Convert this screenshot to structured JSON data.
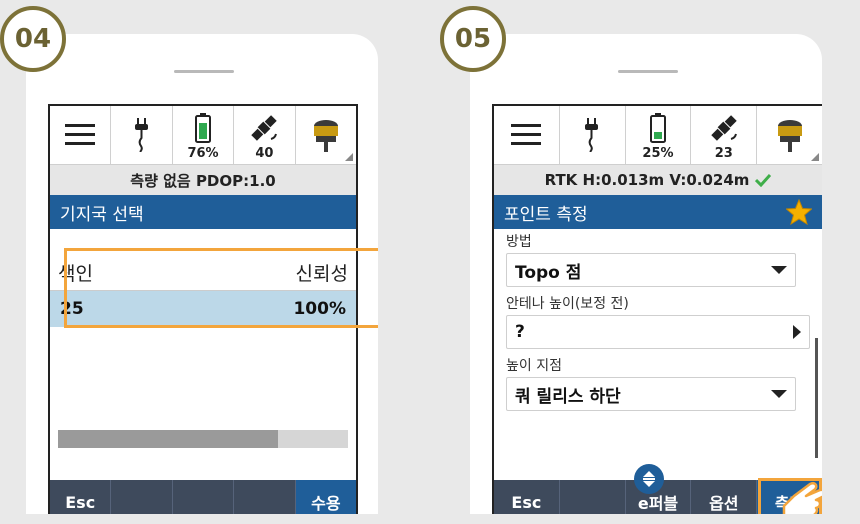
{
  "panel1": {
    "step": "04",
    "battery_pct": "76%",
    "satellites": "40",
    "info_text": "측량 없음 PDOP:1.0",
    "title": "기지국 선택",
    "table": {
      "col_index": "색인",
      "col_reliability": "신뢰성",
      "rows": [
        {
          "index": "25",
          "reliability": "100%"
        }
      ]
    },
    "progress_fraction": 0.76,
    "buttons": [
      "Esc",
      "",
      "",
      "",
      "수용"
    ]
  },
  "panel2": {
    "step": "05",
    "battery_pct": "25%",
    "satellites": "23",
    "info_text": "RTK H:0.013m V:0.024m",
    "title": "포인트 측정",
    "fields": {
      "method_label": "방법",
      "method_value": "Topo 점",
      "antenna_label": "안테나 높이(보정 전)",
      "antenna_value": "?",
      "height_label": "높이 지점",
      "height_value": "쿼 릴리스 하단"
    },
    "buttons": {
      "esc": "Esc",
      "edit": "e퍼블",
      "options": "옵션",
      "measure": "측정"
    }
  },
  "colors": {
    "titlebar": "#1f5e99",
    "bottombar": "#3e4a5c",
    "highlight": "#f3a53c",
    "badge_border": "#7d7238",
    "battery_green": "#2fa84f",
    "check_green": "#3fae49",
    "star": "#f5b000"
  }
}
